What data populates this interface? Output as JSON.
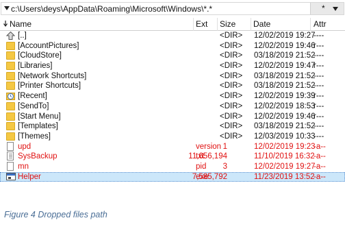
{
  "path_bar": {
    "path": "c:\\Users\\deys\\AppData\\Roaming\\Microsoft\\Windows\\*.*",
    "filter": "*"
  },
  "columns": {
    "name": "Name",
    "ext": "Ext",
    "size": "Size",
    "date": "Date",
    "attr": "Attr"
  },
  "rows": [
    {
      "icon": "up-folder-icon",
      "name": "[..]",
      "ext": "",
      "size": "<DIR>",
      "date": "12/02/2019 19:27",
      "attr": "----",
      "red": false
    },
    {
      "icon": "folder-icon",
      "name": "[AccountPictures]",
      "ext": "",
      "size": "<DIR>",
      "date": "12/02/2019 19:46",
      "attr": "r---",
      "red": false
    },
    {
      "icon": "folder-icon",
      "name": "[CloudStore]",
      "ext": "",
      "size": "<DIR>",
      "date": "03/18/2019 21:52",
      "attr": "----",
      "red": false
    },
    {
      "icon": "folder-icon",
      "name": "[Libraries]",
      "ext": "",
      "size": "<DIR>",
      "date": "12/02/2019 19:47",
      "attr": "r---",
      "red": false
    },
    {
      "icon": "folder-icon",
      "name": "[Network Shortcuts]",
      "ext": "",
      "size": "<DIR>",
      "date": "03/18/2019 21:52",
      "attr": "----",
      "red": false
    },
    {
      "icon": "folder-icon",
      "name": "[Printer Shortcuts]",
      "ext": "",
      "size": "<DIR>",
      "date": "03/18/2019 21:52",
      "attr": "----",
      "red": false
    },
    {
      "icon": "recent-icon",
      "name": "[Recent]",
      "ext": "",
      "size": "<DIR>",
      "date": "12/02/2019 19:39",
      "attr": "r---",
      "red": false
    },
    {
      "icon": "folder-icon",
      "name": "[SendTo]",
      "ext": "",
      "size": "<DIR>",
      "date": "12/02/2019 18:53",
      "attr": "r---",
      "red": false
    },
    {
      "icon": "folder-icon",
      "name": "[Start Menu]",
      "ext": "",
      "size": "<DIR>",
      "date": "12/02/2019 19:46",
      "attr": "r---",
      "red": false
    },
    {
      "icon": "folder-icon",
      "name": "[Templates]",
      "ext": "",
      "size": "<DIR>",
      "date": "03/18/2019 21:52",
      "attr": "----",
      "red": false
    },
    {
      "icon": "folder-icon",
      "name": "[Themes]",
      "ext": "",
      "size": "<DIR>",
      "date": "12/03/2019 10:33",
      "attr": "----",
      "red": false
    },
    {
      "icon": "file-icon",
      "name": "upd",
      "ext": "version",
      "size": "1",
      "date": "12/02/2019 19:23",
      "attr": "-a--",
      "red": true
    },
    {
      "icon": "text-file-icon",
      "name": "SysBackup",
      "ext": "txt",
      "size": "11,656,194",
      "date": "11/10/2019 16:32",
      "attr": "-a--",
      "red": true
    },
    {
      "icon": "file-icon",
      "name": "mn",
      "ext": "pid",
      "size": "3",
      "date": "12/02/2019 19:27",
      "attr": "-a--",
      "red": true
    },
    {
      "icon": "exe-icon",
      "name": "Helper",
      "ext": "exe",
      "size": "7,585,792",
      "date": "11/23/2019 13:52",
      "attr": "-a--",
      "red": true,
      "selected": true
    }
  ],
  "caption": "Figure 4 Dropped files path"
}
